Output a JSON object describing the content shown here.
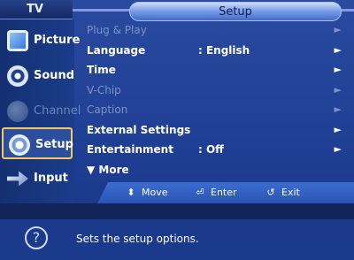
{
  "header": {
    "tv_label": "TV",
    "menu_title": "Setup"
  },
  "sidebar": {
    "items": [
      {
        "label": "Picture",
        "icon": "picture-icon",
        "state": "normal"
      },
      {
        "label": "Sound",
        "icon": "sound-icon",
        "state": "normal"
      },
      {
        "label": "Channel",
        "icon": "channel-icon",
        "state": "disabled"
      },
      {
        "label": "Setup",
        "icon": "setup-icon",
        "state": "selected"
      },
      {
        "label": "Input",
        "icon": "input-icon",
        "state": "normal"
      }
    ]
  },
  "menu": {
    "rows": [
      {
        "label": "Plug & Play",
        "value": "",
        "arrow": "►",
        "disabled": true
      },
      {
        "label": "Language",
        "value": ": English",
        "arrow": "►",
        "disabled": false
      },
      {
        "label": "Time",
        "value": "",
        "arrow": "►",
        "disabled": false
      },
      {
        "label": "V-Chip",
        "value": "",
        "arrow": "►",
        "disabled": true
      },
      {
        "label": "Caption",
        "value": "",
        "arrow": "►",
        "disabled": true
      },
      {
        "label": "External Settings",
        "value": "",
        "arrow": "►",
        "disabled": false
      },
      {
        "label": "Entertainment",
        "value": ": Off",
        "arrow": "►",
        "disabled": false
      },
      {
        "label": "▼ More",
        "value": "",
        "arrow": "",
        "disabled": false
      }
    ]
  },
  "help_bar": {
    "move": "Move",
    "enter": "Enter",
    "exit": "Exit"
  },
  "info": {
    "text": "Sets the setup options.",
    "help_symbol": "?"
  }
}
